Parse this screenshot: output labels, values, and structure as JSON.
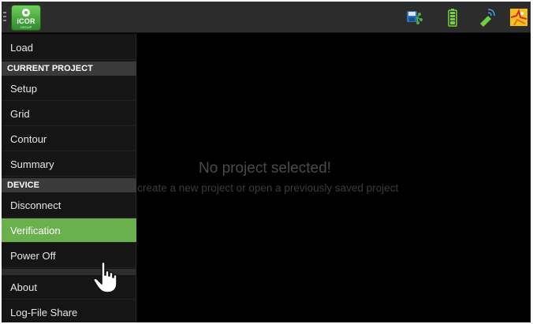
{
  "app": {
    "logo_text": "iCOR",
    "logo_sub": "GROUP"
  },
  "status_icons": [
    "save-network-icon",
    "battery-icon",
    "wireless-signal-icon",
    "map-icon"
  ],
  "drawer": {
    "load": "Load",
    "current_project_header": "CURRENT PROJECT",
    "setup": "Setup",
    "grid": "Grid",
    "contour": "Contour",
    "summary": "Summary",
    "device_header": "DEVICE",
    "disconnect": "Disconnect",
    "verification": "Verification",
    "power_off": "Power Off",
    "about": "About",
    "log_file_share": "Log-File Share",
    "selected": "Verification"
  },
  "main": {
    "empty_title": "No project selected!",
    "empty_subtitle": "e create a new project or open a previously saved project"
  },
  "colors": {
    "accent_green": "#6ab04c",
    "background": "#000000",
    "drawer_bg": "#151515"
  }
}
